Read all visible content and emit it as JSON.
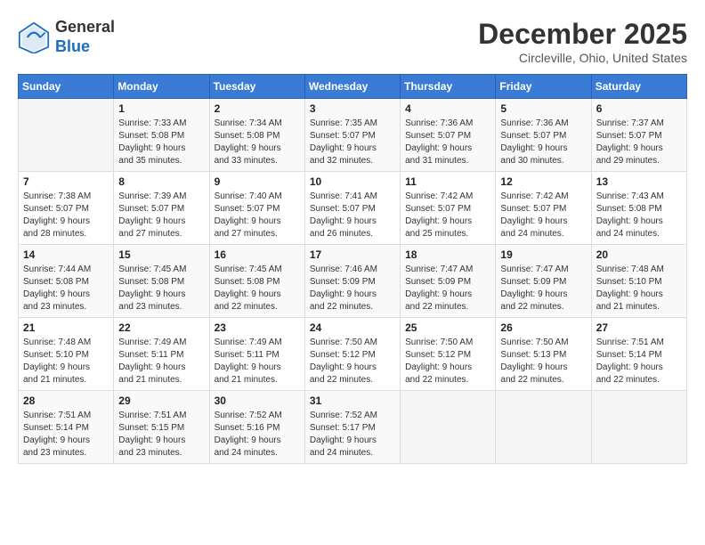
{
  "header": {
    "logo_general": "General",
    "logo_blue": "Blue",
    "month": "December 2025",
    "location": "Circleville, Ohio, United States"
  },
  "days_of_week": [
    "Sunday",
    "Monday",
    "Tuesday",
    "Wednesday",
    "Thursday",
    "Friday",
    "Saturday"
  ],
  "weeks": [
    [
      {
        "day": "",
        "info": ""
      },
      {
        "day": "1",
        "info": "Sunrise: 7:33 AM\nSunset: 5:08 PM\nDaylight: 9 hours\nand 35 minutes."
      },
      {
        "day": "2",
        "info": "Sunrise: 7:34 AM\nSunset: 5:08 PM\nDaylight: 9 hours\nand 33 minutes."
      },
      {
        "day": "3",
        "info": "Sunrise: 7:35 AM\nSunset: 5:07 PM\nDaylight: 9 hours\nand 32 minutes."
      },
      {
        "day": "4",
        "info": "Sunrise: 7:36 AM\nSunset: 5:07 PM\nDaylight: 9 hours\nand 31 minutes."
      },
      {
        "day": "5",
        "info": "Sunrise: 7:36 AM\nSunset: 5:07 PM\nDaylight: 9 hours\nand 30 minutes."
      },
      {
        "day": "6",
        "info": "Sunrise: 7:37 AM\nSunset: 5:07 PM\nDaylight: 9 hours\nand 29 minutes."
      }
    ],
    [
      {
        "day": "7",
        "info": "Sunrise: 7:38 AM\nSunset: 5:07 PM\nDaylight: 9 hours\nand 28 minutes."
      },
      {
        "day": "8",
        "info": "Sunrise: 7:39 AM\nSunset: 5:07 PM\nDaylight: 9 hours\nand 27 minutes."
      },
      {
        "day": "9",
        "info": "Sunrise: 7:40 AM\nSunset: 5:07 PM\nDaylight: 9 hours\nand 27 minutes."
      },
      {
        "day": "10",
        "info": "Sunrise: 7:41 AM\nSunset: 5:07 PM\nDaylight: 9 hours\nand 26 minutes."
      },
      {
        "day": "11",
        "info": "Sunrise: 7:42 AM\nSunset: 5:07 PM\nDaylight: 9 hours\nand 25 minutes."
      },
      {
        "day": "12",
        "info": "Sunrise: 7:42 AM\nSunset: 5:07 PM\nDaylight: 9 hours\nand 24 minutes."
      },
      {
        "day": "13",
        "info": "Sunrise: 7:43 AM\nSunset: 5:08 PM\nDaylight: 9 hours\nand 24 minutes."
      }
    ],
    [
      {
        "day": "14",
        "info": "Sunrise: 7:44 AM\nSunset: 5:08 PM\nDaylight: 9 hours\nand 23 minutes."
      },
      {
        "day": "15",
        "info": "Sunrise: 7:45 AM\nSunset: 5:08 PM\nDaylight: 9 hours\nand 23 minutes."
      },
      {
        "day": "16",
        "info": "Sunrise: 7:45 AM\nSunset: 5:08 PM\nDaylight: 9 hours\nand 22 minutes."
      },
      {
        "day": "17",
        "info": "Sunrise: 7:46 AM\nSunset: 5:09 PM\nDaylight: 9 hours\nand 22 minutes."
      },
      {
        "day": "18",
        "info": "Sunrise: 7:47 AM\nSunset: 5:09 PM\nDaylight: 9 hours\nand 22 minutes."
      },
      {
        "day": "19",
        "info": "Sunrise: 7:47 AM\nSunset: 5:09 PM\nDaylight: 9 hours\nand 22 minutes."
      },
      {
        "day": "20",
        "info": "Sunrise: 7:48 AM\nSunset: 5:10 PM\nDaylight: 9 hours\nand 21 minutes."
      }
    ],
    [
      {
        "day": "21",
        "info": "Sunrise: 7:48 AM\nSunset: 5:10 PM\nDaylight: 9 hours\nand 21 minutes."
      },
      {
        "day": "22",
        "info": "Sunrise: 7:49 AM\nSunset: 5:11 PM\nDaylight: 9 hours\nand 21 minutes."
      },
      {
        "day": "23",
        "info": "Sunrise: 7:49 AM\nSunset: 5:11 PM\nDaylight: 9 hours\nand 21 minutes."
      },
      {
        "day": "24",
        "info": "Sunrise: 7:50 AM\nSunset: 5:12 PM\nDaylight: 9 hours\nand 22 minutes."
      },
      {
        "day": "25",
        "info": "Sunrise: 7:50 AM\nSunset: 5:12 PM\nDaylight: 9 hours\nand 22 minutes."
      },
      {
        "day": "26",
        "info": "Sunrise: 7:50 AM\nSunset: 5:13 PM\nDaylight: 9 hours\nand 22 minutes."
      },
      {
        "day": "27",
        "info": "Sunrise: 7:51 AM\nSunset: 5:14 PM\nDaylight: 9 hours\nand 22 minutes."
      }
    ],
    [
      {
        "day": "28",
        "info": "Sunrise: 7:51 AM\nSunset: 5:14 PM\nDaylight: 9 hours\nand 23 minutes."
      },
      {
        "day": "29",
        "info": "Sunrise: 7:51 AM\nSunset: 5:15 PM\nDaylight: 9 hours\nand 23 minutes."
      },
      {
        "day": "30",
        "info": "Sunrise: 7:52 AM\nSunset: 5:16 PM\nDaylight: 9 hours\nand 24 minutes."
      },
      {
        "day": "31",
        "info": "Sunrise: 7:52 AM\nSunset: 5:17 PM\nDaylight: 9 hours\nand 24 minutes."
      },
      {
        "day": "",
        "info": ""
      },
      {
        "day": "",
        "info": ""
      },
      {
        "day": "",
        "info": ""
      }
    ]
  ]
}
